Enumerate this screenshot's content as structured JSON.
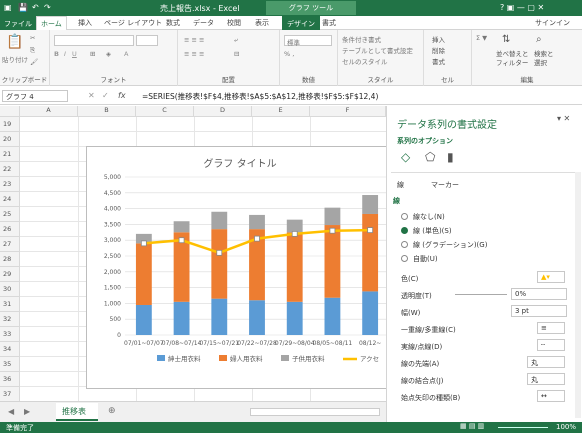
{
  "title": {
    "file": "売上報告.xlsx - Excel",
    "context_tab": "グラフ ツール",
    "window_ctrl": "? ▣ — ▢ ✕"
  },
  "tabs": [
    "ファイル",
    "ホーム",
    "挿入",
    "ページ レイアウト",
    "数式",
    "データ",
    "校閲",
    "表示",
    "デザイン",
    "書式"
  ],
  "signin": "サインイン",
  "ribbon": {
    "clipboard": {
      "paste": "貼り付け",
      "label": "クリップボード"
    },
    "font": {
      "label": "フォント"
    },
    "align": {
      "label": "配置"
    },
    "number": {
      "format": "標準",
      "label": "数値"
    },
    "style": {
      "cond": "条件付き書式",
      "table": "テーブルとして書式設定",
      "cell": "セルのスタイル",
      "label": "スタイル"
    },
    "cells": {
      "insert": "挿入",
      "delete": "削除",
      "format": "書式",
      "label": "セル"
    },
    "edit": {
      "sort": "並べ替えと",
      "sort2": "フィルター",
      "find": "検索と",
      "find2": "選択",
      "label": "編集"
    }
  },
  "formula_bar": {
    "name_box": "グラフ 4",
    "fx": "fx",
    "formula": "=SERIES(推移表!$F$4,推移表!$A$5:$A$12,推移表!$F$5:$F$12,4)"
  },
  "columns": [
    "A",
    "B",
    "C",
    "D",
    "E",
    "F"
  ],
  "rows": [
    "19",
    "20",
    "21",
    "22",
    "23",
    "24",
    "25",
    "26",
    "27",
    "28",
    "29",
    "30",
    "31",
    "32",
    "33",
    "34",
    "35",
    "36",
    "37",
    "38"
  ],
  "chart_data": {
    "type": "bar",
    "title": "グラフ タイトル",
    "categories": [
      "07/01~07/07",
      "07/08~07/14",
      "07/15~07/21",
      "07/22~07/28",
      "07/29~08/04",
      "08/05~08/11",
      "08/12~"
    ],
    "ylim": [
      0,
      5000
    ],
    "yticks": [
      "0",
      "500",
      "1,000",
      "1,500",
      "2,000",
      "2,500",
      "3,000",
      "3,500",
      "4,000",
      "4,500",
      "5,000"
    ],
    "series": [
      {
        "name": "紳士用衣料",
        "color": "#5b9bd5",
        "values": [
          950,
          1050,
          1150,
          1100,
          1050,
          1180,
          1380
        ]
      },
      {
        "name": "婦人用衣料",
        "color": "#ed7d31",
        "values": [
          1950,
          2200,
          2200,
          2250,
          2200,
          2300,
          2450
        ]
      },
      {
        "name": "子供用衣料",
        "color": "#a5a5a5",
        "values": [
          300,
          350,
          550,
          450,
          400,
          550,
          600
        ]
      },
      {
        "name": "アクセ",
        "color": "#ffc000",
        "line": true,
        "values": [
          2900,
          3000,
          2600,
          3050,
          3200,
          3300,
          3320
        ]
      }
    ]
  },
  "panel": {
    "title": "データ系列の書式設定",
    "subtitle": "系列のオプション",
    "line_tab": "線",
    "marker_tab": "マーカー",
    "section": "線",
    "opts": [
      "線なし(N)",
      "線 (単色)(S)",
      "線 (グラデーション)(G)",
      "自動(U)"
    ],
    "color": "色(C)",
    "transparency": "透明度(T)",
    "transparency_val": "0%",
    "width": "幅(W)",
    "width_val": "3 pt",
    "compound": "一重線/多重線(C)",
    "dash": "実線/点線(D)",
    "cap": "線の先端(A)",
    "cap_val": "丸",
    "join": "線の結合点(J)",
    "join_val": "丸",
    "arrow": "始点矢印の種類(B)"
  },
  "sheet_tab": "推移表",
  "status": {
    "ready": "準備完了",
    "zoom": "100%"
  }
}
